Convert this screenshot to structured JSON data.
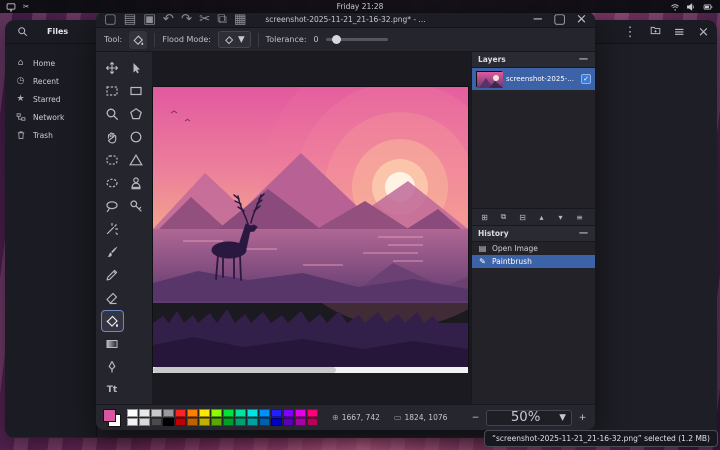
{
  "topbar": {
    "clock": "Friday 21:28"
  },
  "files": {
    "title": "Files",
    "sidebar": [
      {
        "label": "Home"
      },
      {
        "label": "Recent"
      },
      {
        "label": "Starred"
      },
      {
        "label": "Network"
      },
      {
        "label": "Trash"
      }
    ],
    "status": "“screenshot-2025-11-21_21-16-32.png” selected (1.2 MB)"
  },
  "editor": {
    "title": "screenshot-2025-11-21_21-16-32.png* - ...",
    "toolbar": {
      "tool_label": "Tool:",
      "flood_mode_label": "Flood Mode:",
      "tolerance_label": "Tolerance:",
      "tolerance_value": "0"
    },
    "layers": {
      "title": "Layers",
      "layer_name": "screenshot-2025-..."
    },
    "history": {
      "title": "History",
      "entries": [
        {
          "label": "Open Image"
        },
        {
          "label": "Paintbrush"
        }
      ]
    },
    "status": {
      "position": "1667, 742",
      "size": "1824, 1076",
      "zoom": "50%"
    },
    "colors": {
      "primary": "#d8569f",
      "secondary": "#ffffff"
    },
    "palette_row1": [
      "#ffffff",
      "#e8e8e8",
      "#c8c8c8",
      "#9a9a9a",
      "#ff2222",
      "#ff7f00",
      "#ffe900",
      "#8cff00",
      "#00e436",
      "#00e4a0",
      "#00e4e4",
      "#0090ff",
      "#2020ff",
      "#8000ff",
      "#e400e4",
      "#ff0078"
    ],
    "palette_row2": [
      "#f4f4f4",
      "#d8d8d8",
      "#4a4a4a",
      "#000000",
      "#c00000",
      "#c06000",
      "#c0b000",
      "#58a800",
      "#00a028",
      "#00a070",
      "#00a0a0",
      "#0060b0",
      "#0000c0",
      "#5c00b8",
      "#a800a8",
      "#b80058"
    ]
  },
  "icons": {
    "chevron_down": "▾",
    "minimize": "−",
    "maximize": "▢",
    "close": "×",
    "kebab": "⋮",
    "hamburger": "≡",
    "collapse": "−",
    "check": "✓",
    "zoom_out": "−",
    "zoom_in": "+",
    "new_doc": "▢",
    "open_doc": "▤",
    "save_doc": "▣",
    "undo": "↶",
    "redo": "↷",
    "cut": "✂",
    "copy": "⧉",
    "paste": "▦",
    "add_layer": "⊞",
    "duplicate_layer": "⧉",
    "merge_layer": "⊟",
    "raise_layer": "▴",
    "lower_layer": "▾",
    "layer_props": "≡",
    "open_image": "▤",
    "paintbrush": "✎",
    "position": "⊕",
    "size": "▭",
    "home": "⌂",
    "recent": "◷",
    "star": "★",
    "scissors": "✂",
    "text_tool": "Tt"
  }
}
